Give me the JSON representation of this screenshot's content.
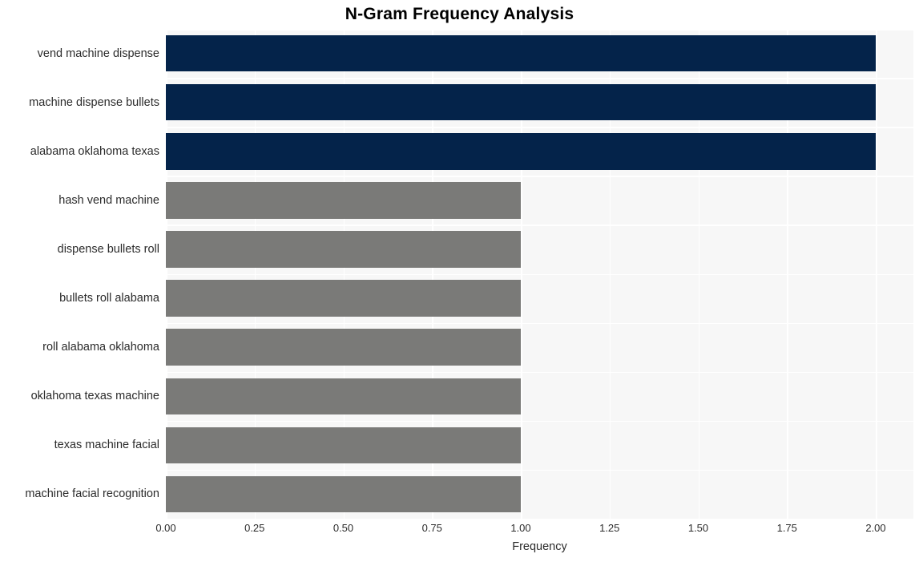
{
  "chart_data": {
    "type": "bar",
    "orientation": "horizontal",
    "title": "N-Gram Frequency Analysis",
    "xlabel": "Frequency",
    "ylabel": "",
    "xlim": [
      0.0,
      2.0
    ],
    "xticks": [
      "0.00",
      "0.25",
      "0.50",
      "0.75",
      "1.00",
      "1.25",
      "1.50",
      "1.75",
      "2.00"
    ],
    "xtick_values": [
      0.0,
      0.25,
      0.5,
      0.75,
      1.0,
      1.25,
      1.5,
      1.75,
      2.0
    ],
    "grid": true,
    "legend": false,
    "categories": [
      "vend machine dispense",
      "machine dispense bullets",
      "alabama oklahoma texas",
      "hash vend machine",
      "dispense bullets roll",
      "bullets roll alabama",
      "roll alabama oklahoma",
      "oklahoma texas machine",
      "texas machine facial",
      "machine facial recognition"
    ],
    "values": [
      2,
      2,
      2,
      1,
      1,
      1,
      1,
      1,
      1,
      1
    ],
    "bar_colors": [
      "#04234a",
      "#04234a",
      "#04234a",
      "#7a7a78",
      "#7a7a78",
      "#7a7a78",
      "#7a7a78",
      "#7a7a78",
      "#7a7a78",
      "#7a7a78"
    ],
    "palette": {
      "highlight": "#04234a",
      "normal": "#7a7a78",
      "plot_background": "#f7f7f7",
      "gridline": "#ffffff",
      "figure_background": "#ffffff",
      "text": "#2b2b2b",
      "title_text": "#000000"
    }
  }
}
